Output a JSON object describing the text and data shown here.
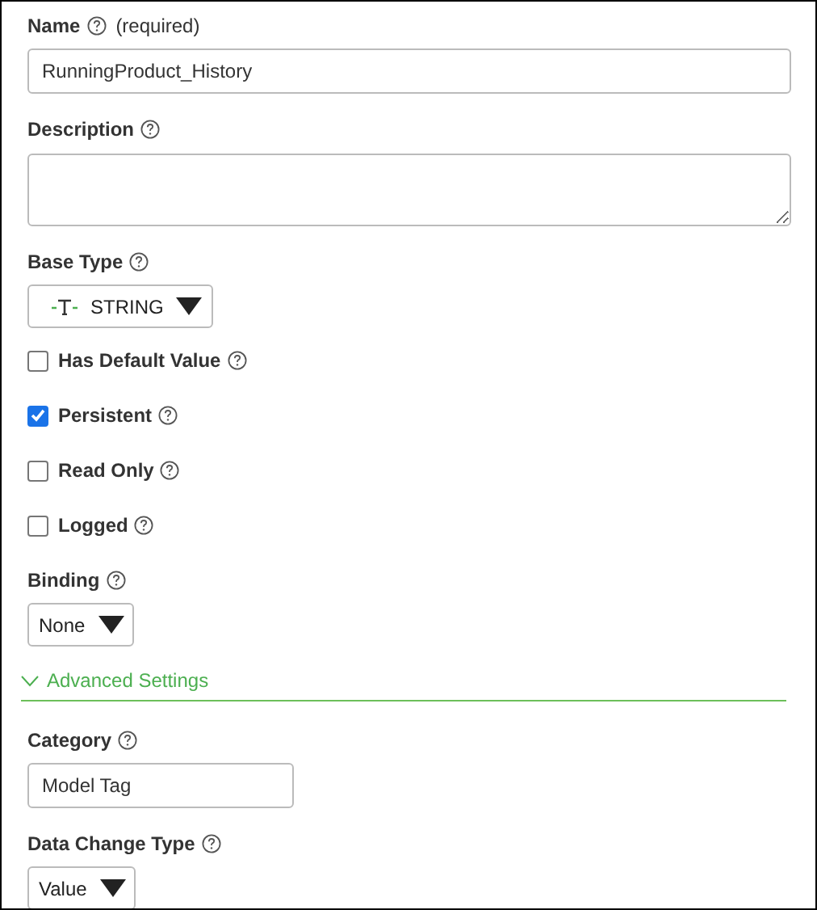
{
  "fields": [
    {
      "kind": "text",
      "label": "Name",
      "note": "(required)",
      "value": "RunningProduct_History"
    },
    {
      "kind": "textarea",
      "label": "Description"
    },
    {
      "kind": "type-select",
      "label": "Base Type",
      "value": "STRING"
    },
    {
      "kind": "checkbox",
      "label": "Has Default Value",
      "checked": false
    },
    {
      "kind": "checkbox",
      "label": "Persistent",
      "checked": true
    },
    {
      "kind": "checkbox",
      "label": "Read Only",
      "checked": false
    },
    {
      "kind": "checkbox",
      "label": "Logged",
      "checked": false
    },
    {
      "kind": "select",
      "label": "Binding",
      "value": "None"
    },
    {
      "kind": "section",
      "label": "Advanced Settings",
      "expanded": true
    },
    {
      "kind": "short-text",
      "label": "Category",
      "value": "Model Tag"
    },
    {
      "kind": "select",
      "label": "Data Change Type",
      "value": "Value"
    }
  ]
}
